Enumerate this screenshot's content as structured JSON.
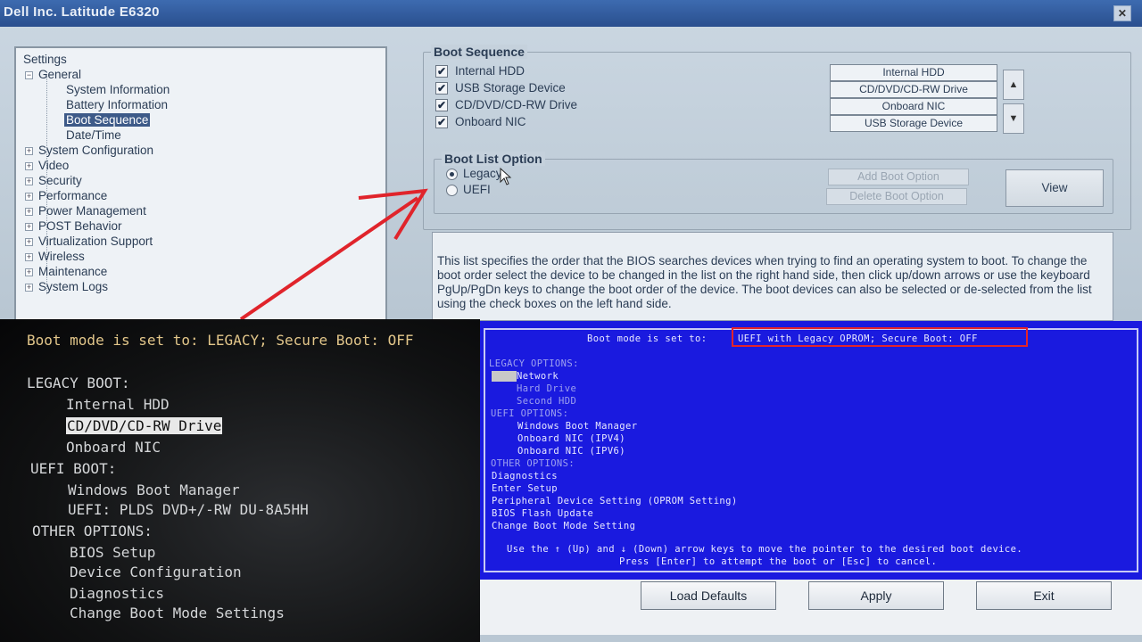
{
  "window": {
    "title": "Dell Inc. Latitude E6320",
    "close_glyph": "✕"
  },
  "tree": {
    "root": "Settings",
    "general": "General",
    "general_children": [
      "System Information",
      "Battery Information",
      "Boot Sequence",
      "Date/Time"
    ],
    "selected": "Boot Sequence",
    "categories": [
      "System Configuration",
      "Video",
      "Security",
      "Performance",
      "Power Management",
      "POST Behavior",
      "Virtualization Support",
      "Wireless",
      "Maintenance",
      "System Logs"
    ]
  },
  "boot_sequence": {
    "title": "Boot Sequence",
    "devices": [
      {
        "label": "Internal HDD",
        "checked": true
      },
      {
        "label": "USB Storage Device",
        "checked": true
      },
      {
        "label": "CD/DVD/CD-RW Drive",
        "checked": true
      },
      {
        "label": "Onboard NIC",
        "checked": true
      }
    ],
    "order": [
      "Internal HDD",
      "CD/DVD/CD-RW Drive",
      "Onboard NIC",
      "USB Storage Device"
    ],
    "check_glyph": "✔"
  },
  "boot_list_option": {
    "title": "Boot List Option",
    "options": [
      {
        "label": "Legacy",
        "selected": true
      },
      {
        "label": "UEFI",
        "selected": false
      }
    ],
    "add_button": "Add Boot Option",
    "delete_button": "Delete Boot Option",
    "view_button": "View"
  },
  "help_text": "This list specifies the order that the BIOS searches devices when trying to find an operating system to boot. To change the boot order select the device to be changed in the list on the right hand side, then click up/down arrows or use the keyboard PgUp/PgDn keys to change the boot order of the device. The boot devices can also be selected or de-selected from the list using the check boxes on the left hand side.",
  "legacy_screen": {
    "status": "Boot mode is set to: LEGACY; Secure Boot: OFF",
    "legacy_header": "LEGACY BOOT:",
    "legacy_items": [
      "Internal HDD",
      "CD/DVD/CD-RW Drive",
      "Onboard NIC"
    ],
    "selected_item": "CD/DVD/CD-RW Drive",
    "uefi_header": "UEFI BOOT:",
    "uefi_items": [
      "Windows Boot Manager",
      "UEFI: PLDS DVD+/-RW DU-8A5HH"
    ],
    "other_header": "OTHER OPTIONS:",
    "other_items": [
      "BIOS Setup",
      "Device Configuration",
      "Diagnostics",
      "Change Boot Mode Settings"
    ]
  },
  "uefi_screen": {
    "status_prefix": "Boot mode is set to:",
    "status_value": "UEFI with Legacy OPROM; Secure Boot: OFF",
    "legacy_header": "LEGACY OPTIONS:",
    "legacy_items": [
      "Network",
      "Hard Drive",
      "Second HDD"
    ],
    "uefi_header": "UEFI OPTIONS:",
    "uefi_items": [
      "Windows Boot Manager",
      "Onboard NIC (IPV4)",
      "Onboard NIC (IPV6)"
    ],
    "other_header": "OTHER OPTIONS:",
    "other_items": [
      "Diagnostics",
      "Enter Setup",
      "Peripheral Device Setting (OPROM Setting)",
      "BIOS Flash Update",
      "Change Boot Mode Setting"
    ],
    "help_line1": "Use the ↑ (Up) and ↓ (Down) arrow keys to move the pointer to the desired boot device.",
    "help_line2": "Press [Enter] to attempt the boot or [Esc] to cancel."
  },
  "buttons": {
    "load_defaults": "Load Defaults",
    "apply": "Apply",
    "exit": "Exit"
  },
  "colors": {
    "annotation_arrow": "#e0242b",
    "uefi_background": "#1a1adf",
    "title_bar": "#3d6bb0"
  }
}
